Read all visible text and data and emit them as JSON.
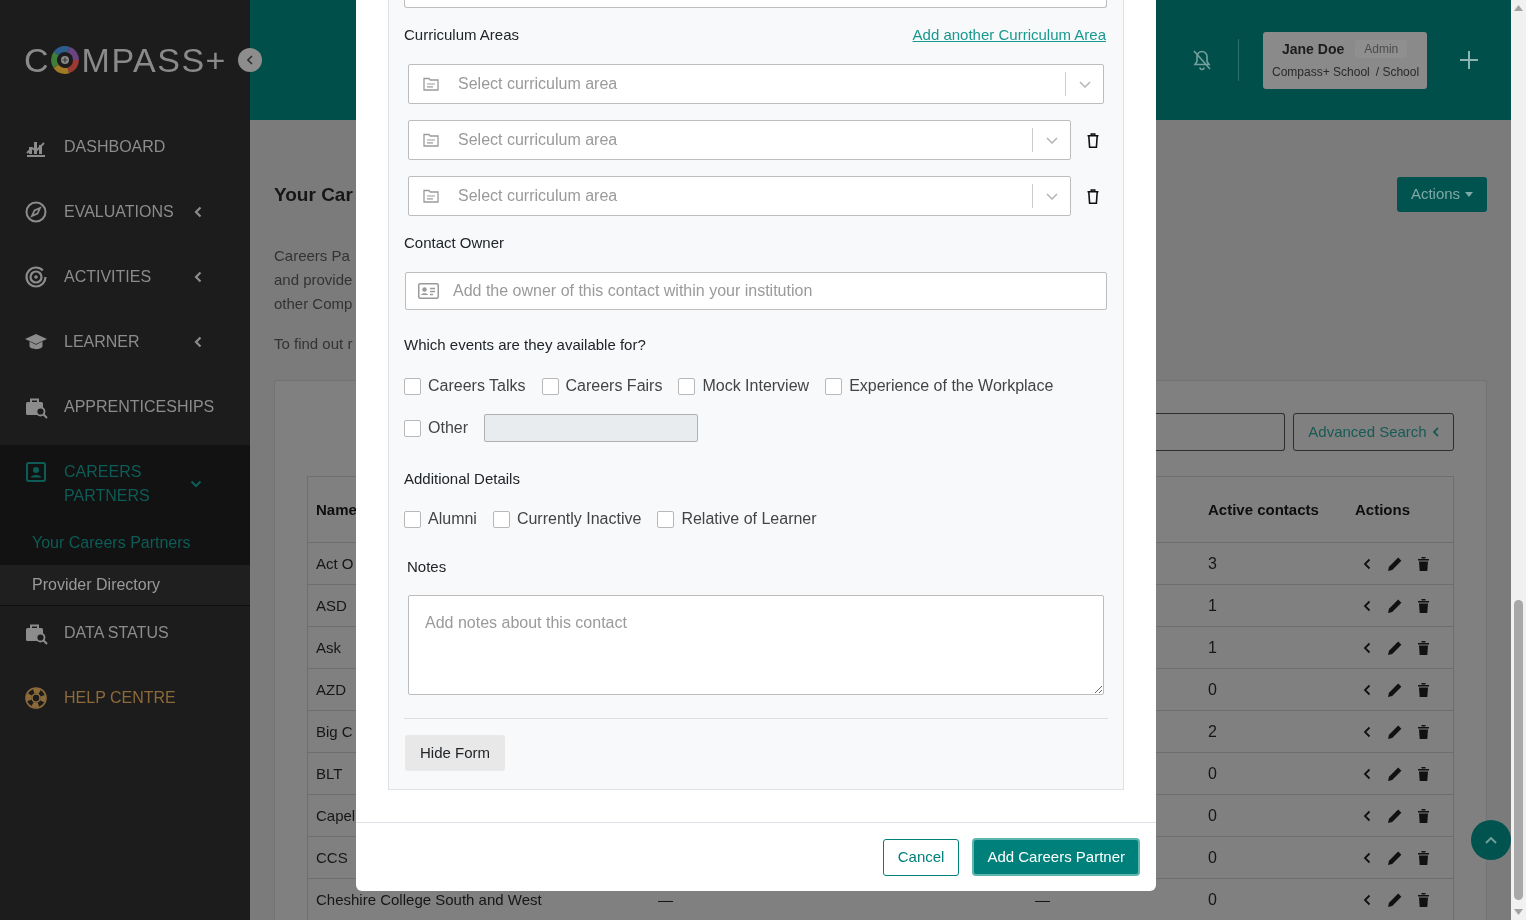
{
  "sidebar": {
    "logo": {
      "text_start": "C",
      "text_end": "MPASS+"
    },
    "items": [
      {
        "label": "DASHBOARD",
        "kind": "link",
        "selected": false
      },
      {
        "label": "EVALUATIONS",
        "kind": "menu",
        "selected": false,
        "expanded": false
      },
      {
        "label": "ACTIVITIES",
        "kind": "menu",
        "selected": false,
        "expanded": false
      },
      {
        "label": "LEARNER",
        "kind": "menu",
        "selected": false,
        "expanded": false
      },
      {
        "label": "APPRENTICESHIPS",
        "kind": "link",
        "selected": false
      },
      {
        "label": "CAREERS PARTNERS",
        "kind": "menu",
        "selected": true,
        "expanded": true,
        "children": [
          {
            "label": "Your Careers Partners",
            "selected": true
          },
          {
            "label": "Provider Directory",
            "selected": false
          }
        ]
      },
      {
        "label": "DATA STATUS",
        "kind": "link",
        "selected": false
      },
      {
        "label": "HELP CENTRE",
        "kind": "help",
        "selected": false
      }
    ]
  },
  "header": {
    "user": {
      "name": "Jane Doe",
      "role": "Admin",
      "school": "Compass+ School",
      "school_type": "/ School"
    }
  },
  "page": {
    "title": "Your Car",
    "intro_lines": [
      "Careers Pa",
      "and provide",
      "other Comp"
    ],
    "more_info": "To find out r",
    "actions_button": "Actions",
    "advanced_search_button": "Advanced Search"
  },
  "table": {
    "columns": [
      "Name",
      "Active contacts",
      "Actions"
    ],
    "rows": [
      {
        "name": "Act O",
        "active_contacts": "3"
      },
      {
        "name": "ASD",
        "active_contacts": "1"
      },
      {
        "name": "Ask",
        "active_contacts": "1"
      },
      {
        "name": "AZD",
        "active_contacts": "0"
      },
      {
        "name": "Big C",
        "active_contacts": "2"
      },
      {
        "name": "BLT",
        "active_contacts": "0"
      },
      {
        "name": "Capel",
        "active_contacts": "0"
      },
      {
        "name": "CCS",
        "active_contacts": "0"
      },
      {
        "name": "Cheshire College South and West",
        "column_2": "—",
        "column_3": "—",
        "active_contacts": "0"
      }
    ]
  },
  "modal": {
    "curriculum": {
      "label": "Curriculum Areas",
      "add_link": "Add another Curriculum Area",
      "selects": [
        {
          "placeholder": "Select curriculum area",
          "removable": false
        },
        {
          "placeholder": "Select curriculum area",
          "removable": true
        },
        {
          "placeholder": "Select curriculum area",
          "removable": true
        }
      ]
    },
    "contact_owner": {
      "label": "Contact Owner",
      "placeholder": "Add the owner of this contact within your institution"
    },
    "events": {
      "label": "Which events are they available for?",
      "options": [
        {
          "label": "Careers Talks",
          "checked": false
        },
        {
          "label": "Careers Fairs",
          "checked": false
        },
        {
          "label": "Mock Interview",
          "checked": false
        },
        {
          "label": "Experience of the Workplace",
          "checked": false
        }
      ],
      "other": {
        "label": "Other",
        "checked": false,
        "field_disabled": true
      }
    },
    "additional": {
      "label": "Additional Details",
      "options": [
        {
          "label": "Alumni",
          "checked": false
        },
        {
          "label": "Currently Inactive",
          "checked": false
        },
        {
          "label": "Relative of Learner",
          "checked": false
        }
      ]
    },
    "notes": {
      "label": "Notes",
      "placeholder": "Add notes about this contact"
    },
    "hide_form_button": "Hide Form",
    "footer_buttons": [
      {
        "label": "Cancel",
        "kind": "secondary"
      },
      {
        "label": "Add Careers Partner",
        "kind": "primary"
      }
    ]
  }
}
